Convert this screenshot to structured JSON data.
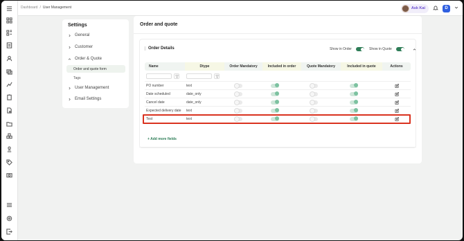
{
  "header": {
    "breadcrumb": [
      "Dashboard",
      "/",
      "User Management"
    ],
    "ask_kai": "Ask Kai",
    "user_initial": "D"
  },
  "settings": {
    "title": "Settings",
    "items": [
      {
        "label": "General"
      },
      {
        "label": "Customer"
      },
      {
        "label": "Order & Quote"
      },
      {
        "label": "User Management"
      },
      {
        "label": "Email Settings"
      }
    ],
    "subitems": [
      {
        "label": "Order and quote form"
      },
      {
        "label": "Tags"
      }
    ]
  },
  "main": {
    "title": "Order and quote",
    "section_title": "Order Details",
    "show_in_order_label": "Show in Order",
    "show_in_quote_label": "Show in Quote",
    "add_more": "+ Add more fields"
  },
  "table": {
    "headers": [
      "Name",
      "Dtype",
      "Order Mandatory",
      "Included in order",
      "Quote Mandatory",
      "Included in quote",
      "Actions"
    ],
    "rows": [
      {
        "name": "PO number",
        "dtype": "text",
        "order_mandatory": false,
        "included_order": true,
        "quote_mandatory": false,
        "included_quote": true
      },
      {
        "name": "Date scheduled",
        "dtype": "date_only",
        "order_mandatory": false,
        "included_order": true,
        "quote_mandatory": false,
        "included_quote": true
      },
      {
        "name": "Cancel date",
        "dtype": "date_only",
        "order_mandatory": false,
        "included_order": true,
        "quote_mandatory": false,
        "included_quote": true
      },
      {
        "name": "Expected delivery date",
        "dtype": "text",
        "order_mandatory": false,
        "included_order": true,
        "quote_mandatory": false,
        "included_quote": true
      },
      {
        "name": "Test",
        "dtype": "text",
        "order_mandatory": false,
        "included_order": true,
        "quote_mandatory": false,
        "included_quote": true
      }
    ]
  },
  "colors": {
    "accent": "#2e7d57",
    "highlight_box": "#d9321f",
    "ask_kai": "#6b4fd0"
  },
  "icons": [
    "menu-icon",
    "dashboard-icon",
    "grid-icon",
    "user-icon",
    "layers-icon",
    "chart-icon",
    "clipboard-icon",
    "file-icon",
    "folder-icon",
    "boxes-icon",
    "person-icon",
    "tag-icon",
    "camera-icon",
    "list-icon",
    "settings-icon",
    "logout-icon",
    "bell-icon",
    "edit-icon",
    "filter-icon"
  ]
}
